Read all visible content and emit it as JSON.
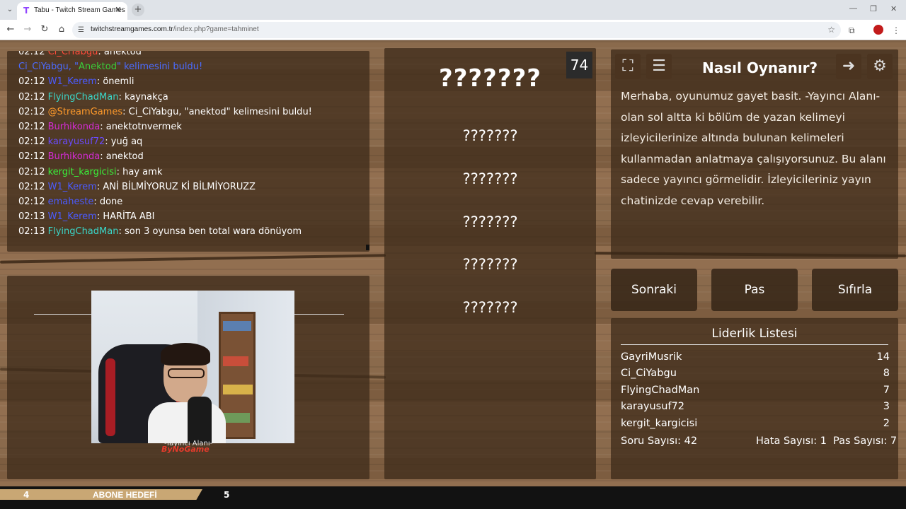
{
  "browser": {
    "tab_title": "Tabu - Twitch Stream Games",
    "tab_icon": "T",
    "url_host": "twitchstreamgames.com.tr",
    "url_path": "/index.php?game=tahminet"
  },
  "chat": {
    "messages": [
      {
        "time": "02:12",
        "user": "Ci_CiYabgu",
        "user_color": "#ff4b3a",
        "text": ": anektod"
      },
      {
        "time": "",
        "user": "Ci_CiYabgu, \"",
        "user_color": "#4b6bff",
        "word": "Anektod",
        "word_color": "#3acb3a",
        "text": "\" kelimesini buldu!",
        "text_color": "#4b6bff"
      },
      {
        "time": "02:12",
        "user": "W1_Kerem",
        "user_color": "#4b5bff",
        "text": ": önemli"
      },
      {
        "time": "02:12",
        "user": "FlyingChadMan",
        "user_color": "#3ad6c8",
        "text": ": kaynakça"
      },
      {
        "time": "02:12",
        "user": "@StreamGames",
        "user_color": "#ff9a2a",
        "text": ": Ci_CiYabgu, \"anektod\" kelimesini buldu!"
      },
      {
        "time": "02:12",
        "user": "Burhikonda",
        "user_color": "#d42bd4",
        "text": ": anektotnvermek"
      },
      {
        "time": "02:12",
        "user": "karayusuf72",
        "user_color": "#6a4bff",
        "text": ": yuğ aq"
      },
      {
        "time": "02:12",
        "user": "Burhikonda",
        "user_color": "#d42bd4",
        "text": ": anektod"
      },
      {
        "time": "02:12",
        "user": "kergit_kargicisi",
        "user_color": "#3aef3a",
        "text": ": hay amk"
      },
      {
        "time": "02:12",
        "user": "W1_Kerem",
        "user_color": "#4b5bff",
        "text": ": ANİ BİLMİYORUZ Kİ BİLMİYORUZZ"
      },
      {
        "time": "02:12",
        "user": "emaheste",
        "user_color": "#4b5bff",
        "text": ": done"
      },
      {
        "time": "02:13",
        "user": "W1_Kerem",
        "user_color": "#4b5bff",
        "text": ": HARİTA ABI"
      },
      {
        "time": "02:13",
        "user": "FlyingChadMan",
        "user_color": "#3ad6c8",
        "text": ": son 3 oyunsa ben total wara dönüyom"
      }
    ]
  },
  "broadcaster": {
    "caption": "-Yayıncı Alanı-",
    "watermark": "ByNoGame"
  },
  "board": {
    "countdown": "74",
    "main_word": "???????",
    "taboo_words": [
      "???????",
      "???????",
      "???????",
      "???????",
      "???????"
    ]
  },
  "howto": {
    "title": "Nasıl Oynanır?",
    "text": "Merhaba, oyunumuz gayet basit. -Yayıncı Alanı- olan sol altta ki bölüm de yazan kelimeyi izleyicilerinize altında bulunan kelimeleri kullanmadan anlatmaya çalışıyorsunuz. Bu alanı sadece yayıncı görmelidir. İzleyicileriniz yayın chatinizde cevap verebilir."
  },
  "controls": {
    "next": "Sonraki",
    "pass": "Pas",
    "reset": "Sıfırla"
  },
  "leaderboard": {
    "title": "Liderlik Listesi",
    "rows": [
      {
        "name": "GayriMusrik",
        "score": "14"
      },
      {
        "name": "Ci_CiYabgu",
        "score": "8"
      },
      {
        "name": "FlyingChadMan",
        "score": "7"
      },
      {
        "name": "karayusuf72",
        "score": "3"
      },
      {
        "name": "kergit_kargicisi",
        "score": "2"
      }
    ],
    "question_count": "Soru Sayısı: 42",
    "error_count": "Hata Sayısı: 1",
    "pass_count": "Pas Sayısı: 7"
  },
  "subscription": {
    "current": "4",
    "label": "ABONE HEDEFİ",
    "target": "5",
    "progress_fraction": 0.8,
    "bar_color": "#c9a774"
  }
}
